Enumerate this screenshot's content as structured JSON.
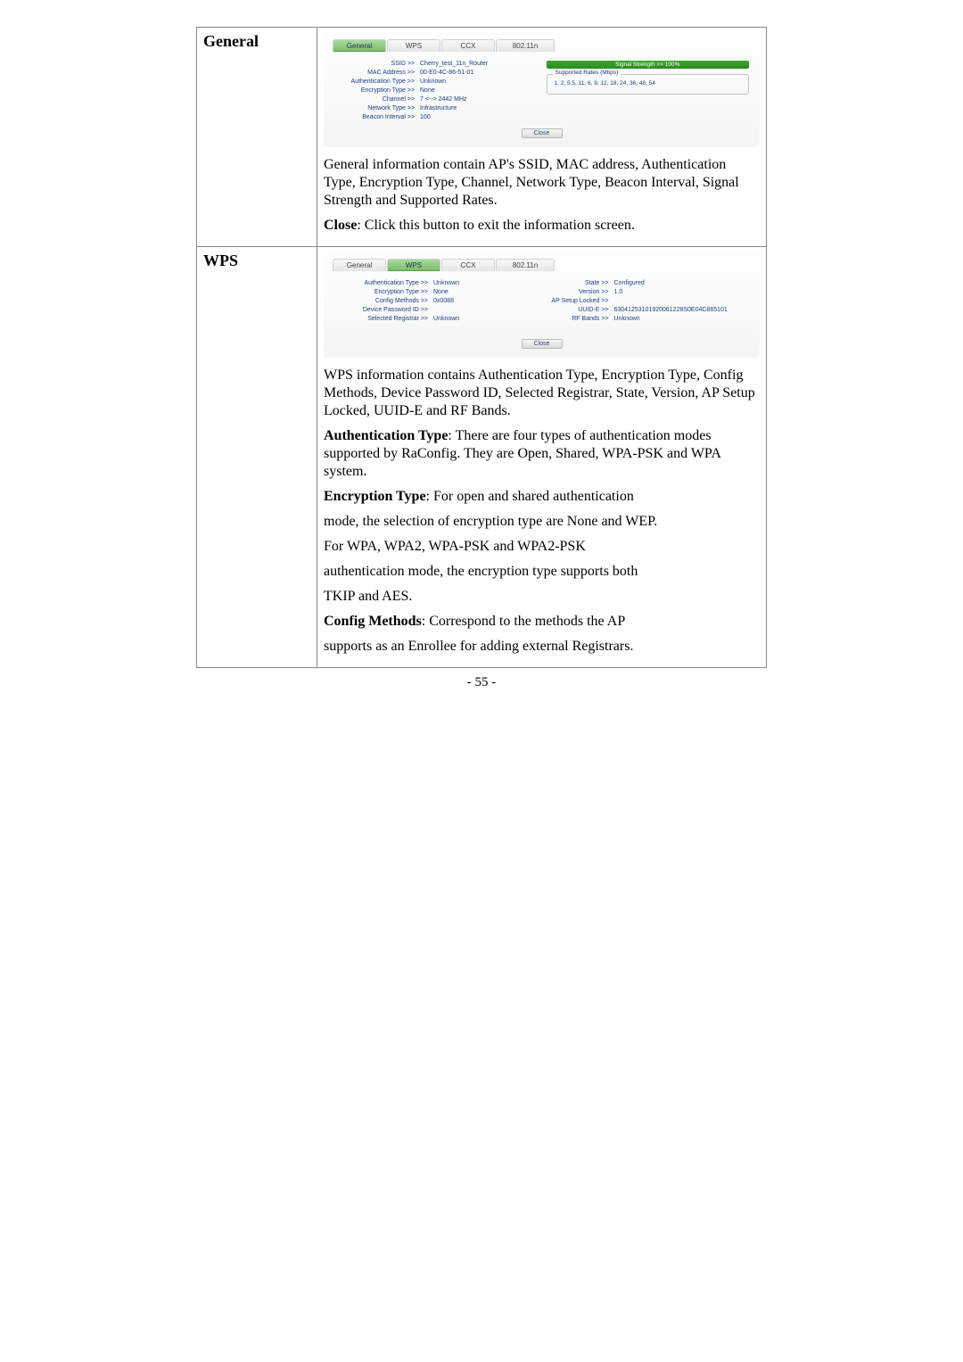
{
  "rows": {
    "general_label": "General",
    "wps_label": "WPS"
  },
  "tabs": {
    "general": "General",
    "wps": "WPS",
    "ccx": "CCX",
    "dot11n": "802.11n"
  },
  "general_panel": {
    "labels": {
      "ssid": "SSID >>",
      "mac": "MAC Address >>",
      "auth": "Authentication Type >>",
      "enc": "Encryption Type >>",
      "channel": "Channel >>",
      "ntype": "Network Type >>",
      "beacon": "Beacon Interval >>"
    },
    "values": {
      "ssid": "Cherry_test_11n_Router",
      "mac": "00-E0-4C-86-51-01",
      "auth": "Unknown",
      "enc": "None",
      "channel": "7 <--> 2442 MHz",
      "ntype": "Infrastructure",
      "beacon": "100"
    },
    "signal": "Signal Strength >> 100%",
    "rates_legend": "Supported Rates (Mbps)",
    "rates": "1, 2, 5.5, 11, 6, 9, 12, 18, 24, 36, 48, 54",
    "close": "Close"
  },
  "wps_panel": {
    "labels": {
      "auth": "Authentication Type >>",
      "enc": "Encryption Type >>",
      "config": "Config Methods >>",
      "devpw": "Device Password ID >>",
      "selreg": "Selected Registrar >>",
      "state": "State >>",
      "version": "Version >>",
      "aplock": "AP Setup Locked >>",
      "uuid": "UUID-E >>",
      "rfbands": "RF Bands >>"
    },
    "values": {
      "auth": "Unknown",
      "enc": "None",
      "config": "0x0088",
      "devpw": "",
      "selreg": "Unknown",
      "state": "Configured",
      "version": "1.0",
      "aplock": "",
      "uuid": "63041253101920061228S0E04C865101",
      "rfbands": "Unknown"
    },
    "close": "Close"
  },
  "desc": {
    "general_p1": "General information contain AP's SSID, MAC address, Authentication Type, Encryption Type, Channel, Network Type, Beacon Interval, Signal Strength and Supported Rates.",
    "general_close_b": "Close",
    "general_close_rest": ": Click this button to exit the information screen.",
    "wps_p1": "WPS information contains Authentication Type, Encryption Type, Config Methods, Device Password ID, Selected Registrar, State, Version, AP Setup Locked, UUID-E and RF Bands.",
    "wps_auth_b": "Authentication Type",
    "wps_auth_rest": ": There are four types of authentication modes supported by RaConfig. They are Open, Shared, WPA-PSK and WPA system.",
    "wps_enc_b": "Encryption Type",
    "wps_enc_rest": ": For open and shared authentication",
    "wps_enc_l2": "mode, the selection of encryption type are None and WEP.",
    "wps_enc_l3": "For WPA, WPA2, WPA-PSK and WPA2-PSK",
    "wps_enc_l4": "authentication mode, the encryption type supports both",
    "wps_enc_l5": "TKIP and AES.",
    "wps_cfg_b": "Config Methods",
    "wps_cfg_rest": ": Correspond to the methods the AP",
    "wps_cfg_l2": "supports as an Enrollee for adding external Registrars."
  },
  "page_number": "- 55 -"
}
